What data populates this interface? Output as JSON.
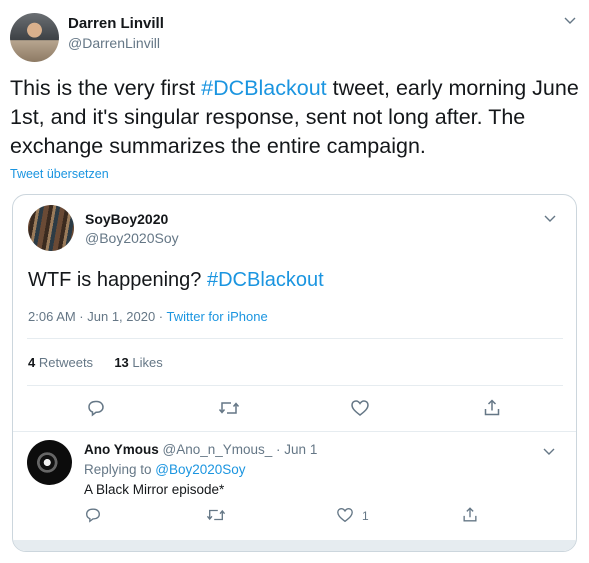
{
  "main_tweet": {
    "author_name": "Darren Linvill",
    "author_handle": "@DarrenLinvill",
    "text_before": "This is the very first ",
    "hashtag": "#DCBlackout",
    "text_after": " tweet, early morning June 1st, and it's singular response, sent not long after. The exchange summarizes the entire campaign.",
    "translate_label": "Tweet übersetzen"
  },
  "quoted_tweet": {
    "author_name": "SoyBoy2020",
    "author_handle": "@Boy2020Soy",
    "text_before": "WTF is happening? ",
    "hashtag": "#DCBlackout",
    "time": "2:06 AM · Jun 1, 2020 · ",
    "source": "Twitter for iPhone",
    "retweets_count": "4",
    "retweets_label": "Retweets",
    "likes_count": "13",
    "likes_label": "Likes"
  },
  "reply": {
    "author_name": "Ano Ymous",
    "author_handle": "@Ano_n_Ymous_ · Jun 1",
    "replying_prefix": "Replying to ",
    "replying_handle": "@Boy2020Soy",
    "text": "A Black Mirror episode*",
    "like_count": "1"
  },
  "icons": {
    "reply": "reply-icon",
    "retweet": "retweet-icon",
    "like": "heart-icon",
    "share": "share-icon",
    "more": "chevron-down-icon"
  },
  "colors": {
    "link": "#1b95e0",
    "text": "#14171a",
    "muted": "#657786",
    "border": "#ccd6dd"
  }
}
